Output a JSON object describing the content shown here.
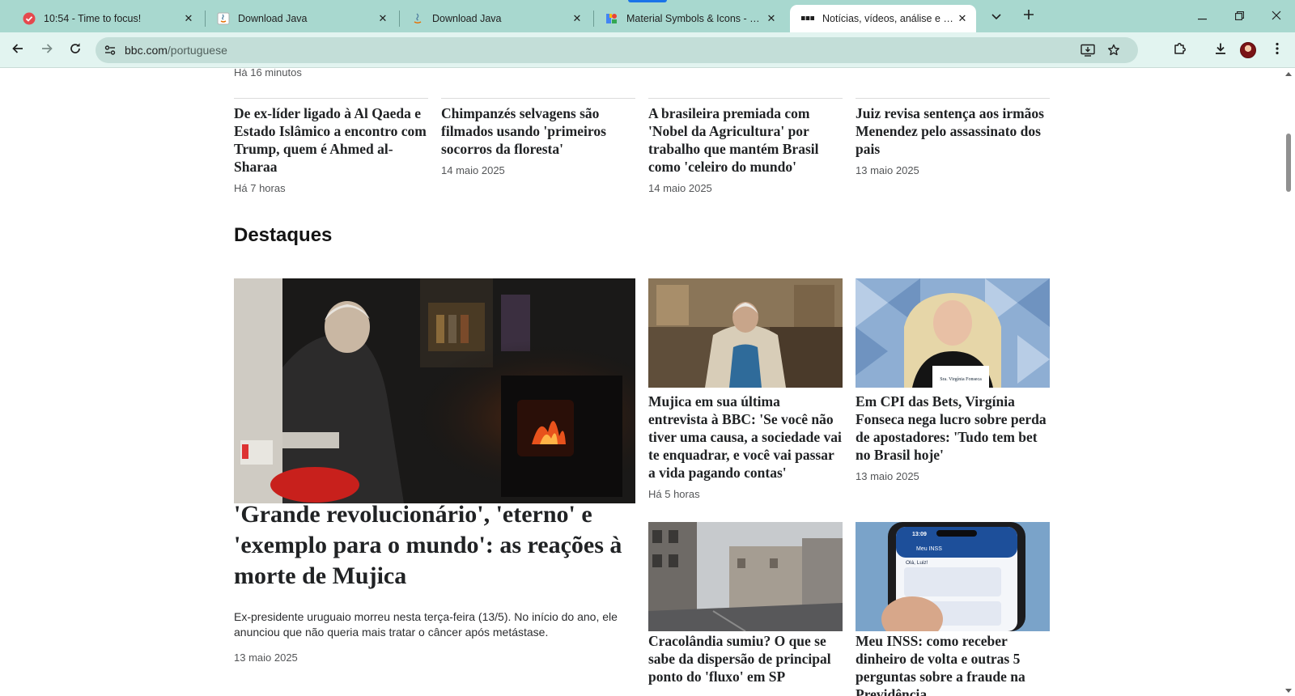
{
  "browser": {
    "tabs": [
      {
        "title": "10:54 - Time to focus!",
        "icon": "check-circle-icon"
      },
      {
        "title": "Download Java",
        "icon": "java-icon"
      },
      {
        "title": "Download Java",
        "icon": "java-icon"
      },
      {
        "title": "Material Symbols & Icons - Google Fonts",
        "icon": "google-fonts-icon"
      },
      {
        "title": "Notícias, vídeos, análise e conteúdo em português",
        "icon": "bbc-icon"
      }
    ],
    "url_domain": "bbc.com",
    "url_path": "/portuguese",
    "accent_color": "#1a73e8",
    "tabstrip_color": "#a8d8cf"
  },
  "page": {
    "top_timestamp": "Há 16 minutos",
    "top_stories": [
      {
        "headline": "De ex-líder ligado à Al Qaeda e Estado Islâmico a encontro com Trump, quem é Ahmed al-Sharaa",
        "date": "Há 7 horas"
      },
      {
        "headline": "Chimpanzés selvagens são filmados usando 'primeiros socorros da floresta'",
        "date": "14 maio 2025"
      },
      {
        "headline": "A brasileira premiada com 'Nobel da Agricultura' por trabalho que mantém Brasil como 'celeiro do mundo'",
        "date": "14 maio 2025"
      },
      {
        "headline": "Juiz revisa sentença aos irmãos Menendez pelo assassinato dos pais",
        "date": "13 maio 2025"
      }
    ],
    "section_title": "Destaques",
    "lead": {
      "headline": "'Grande revolucionário', 'eterno' e 'exemplo para o mundo': as reações à morte de Mujica",
      "summary": "Ex-presidente uruguaio morreu nesta terça-feira (13/5). No início do ano, ele anunciou que não queria mais tratar o câncer após metástase.",
      "date": "13 maio 2025"
    },
    "grid_stories": [
      {
        "headline": "Mujica em sua última entrevista à BBC: 'Se você não tiver uma causa, a sociedade vai te enquadrar, e você vai passar a vida pagando contas'",
        "date": "Há 5 horas"
      },
      {
        "headline": "Em CPI das Bets, Virgínia Fonseca nega lucro sobre perda de apostadores: 'Tudo tem bet no Brasil hoje'",
        "date": "13 maio 2025",
        "image_text": "Sra. Virgínia Fonseca"
      },
      {
        "headline": "Cracolândia sumiu? O que se sabe da dispersão de principal ponto do 'fluxo' em SP",
        "date": ""
      },
      {
        "headline": "Meu INSS: como receber dinheiro de volta e outras 5 perguntas sobre a fraude na Previdência",
        "date": "",
        "image_text": {
          "time": "13:09",
          "app": "Meu INSS",
          "greeting": "Olá, Luiz!"
        }
      }
    ]
  }
}
